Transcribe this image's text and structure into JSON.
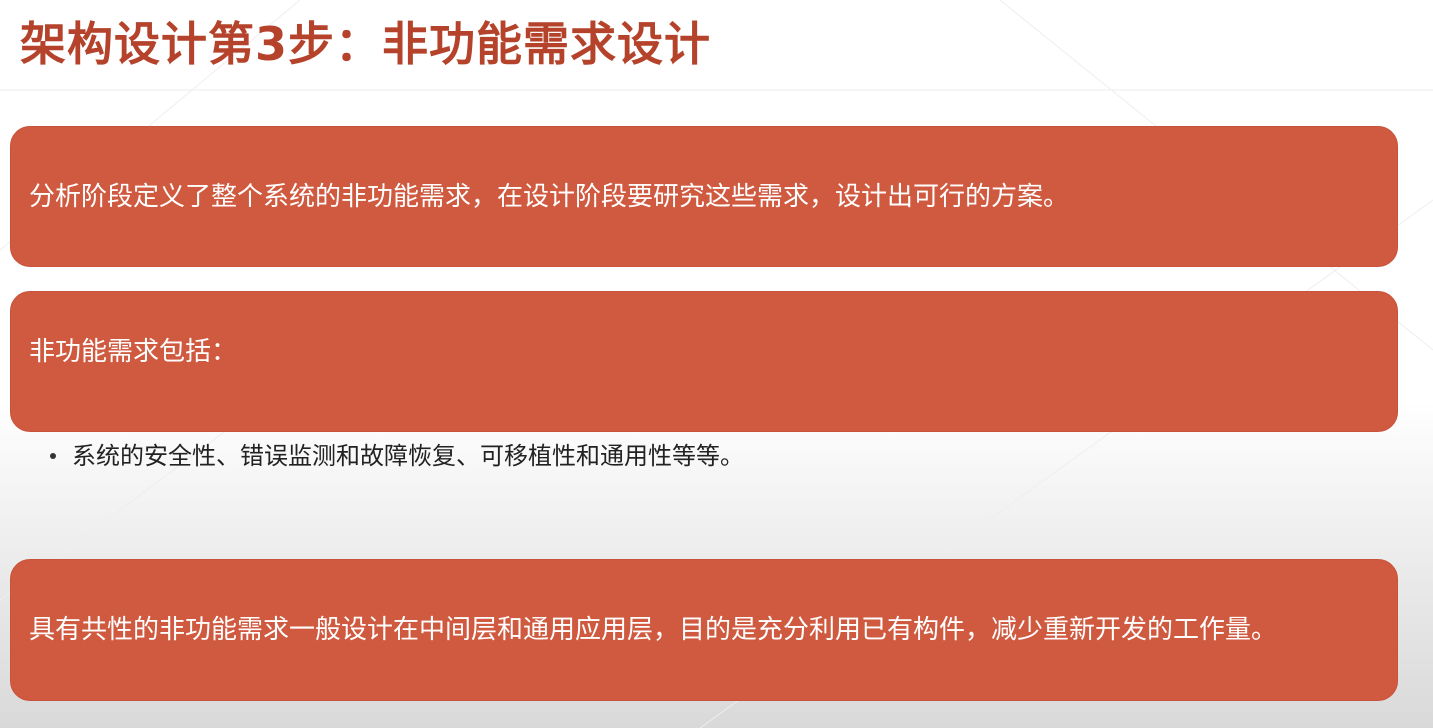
{
  "slide": {
    "title": "架构设计第3步：非功能需求设计",
    "box1_text": "分析阶段定义了整个系统的非功能需求，在设计阶段要研究这些需求，设计出可行的方案。",
    "box2_text": "非功能需求包括：",
    "bullet_text": "系统的安全性、错误监测和故障恢复、可移植性和通用性等等。",
    "box3_text": "具有共性的非功能需求一般设计在中间层和通用应用层，目的是充分利用已有构件，减少重新开发的工作量。"
  },
  "colors": {
    "title": "#b5432b",
    "box_fill": "#d05a40",
    "box_text": "#ffffff",
    "bullet_text": "#222222"
  }
}
